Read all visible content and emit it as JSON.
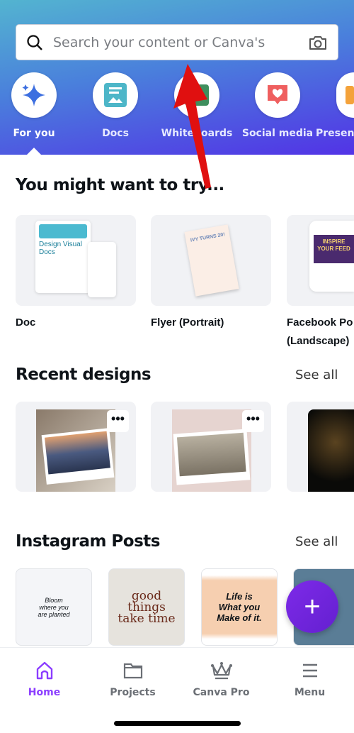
{
  "search": {
    "placeholder": "Search your content or Canva's",
    "search_icon": "search-icon",
    "camera_icon": "camera-icon"
  },
  "categories": [
    {
      "label": "For you",
      "icon": "sparkle-icon",
      "active": true
    },
    {
      "label": "Docs",
      "icon": "doc-icon"
    },
    {
      "label": "Whiteboards",
      "icon": "whiteboard-icon"
    },
    {
      "label": "Social media",
      "icon": "heart-icon"
    },
    {
      "label": "Presen",
      "icon": "presentation-icon"
    }
  ],
  "try": {
    "title": "You might want to try...",
    "items": [
      {
        "label": "Doc",
        "thumb": "Design Visual Docs"
      },
      {
        "label": "Flyer (Portrait)",
        "thumb": "IVY TURNS 20!"
      },
      {
        "label": "Facebook Po",
        "label2": "(Landscape)",
        "thumb": "INSPIRE YOUR FEED"
      }
    ]
  },
  "recent": {
    "title": "Recent designs",
    "see_all": "See all",
    "more": "•••"
  },
  "instagram": {
    "title": "Instagram Posts",
    "see_all": "See all",
    "posts": [
      {
        "text": "Bloom where you are planted"
      },
      {
        "text": "good things take time"
      },
      {
        "text": "Life is What you Make of it."
      },
      {
        "text": ""
      }
    ]
  },
  "fab": {
    "label": "+"
  },
  "nav": [
    {
      "label": "Home",
      "icon": "home-icon",
      "active": true
    },
    {
      "label": "Projects",
      "icon": "folder-icon"
    },
    {
      "label": "Canva Pro",
      "icon": "crown-icon"
    },
    {
      "label": "Menu",
      "icon": "menu-icon"
    }
  ],
  "colors": {
    "accent": "#8b3dff",
    "fab": "#7d2ae8",
    "annotation_arrow": "#e01010"
  }
}
